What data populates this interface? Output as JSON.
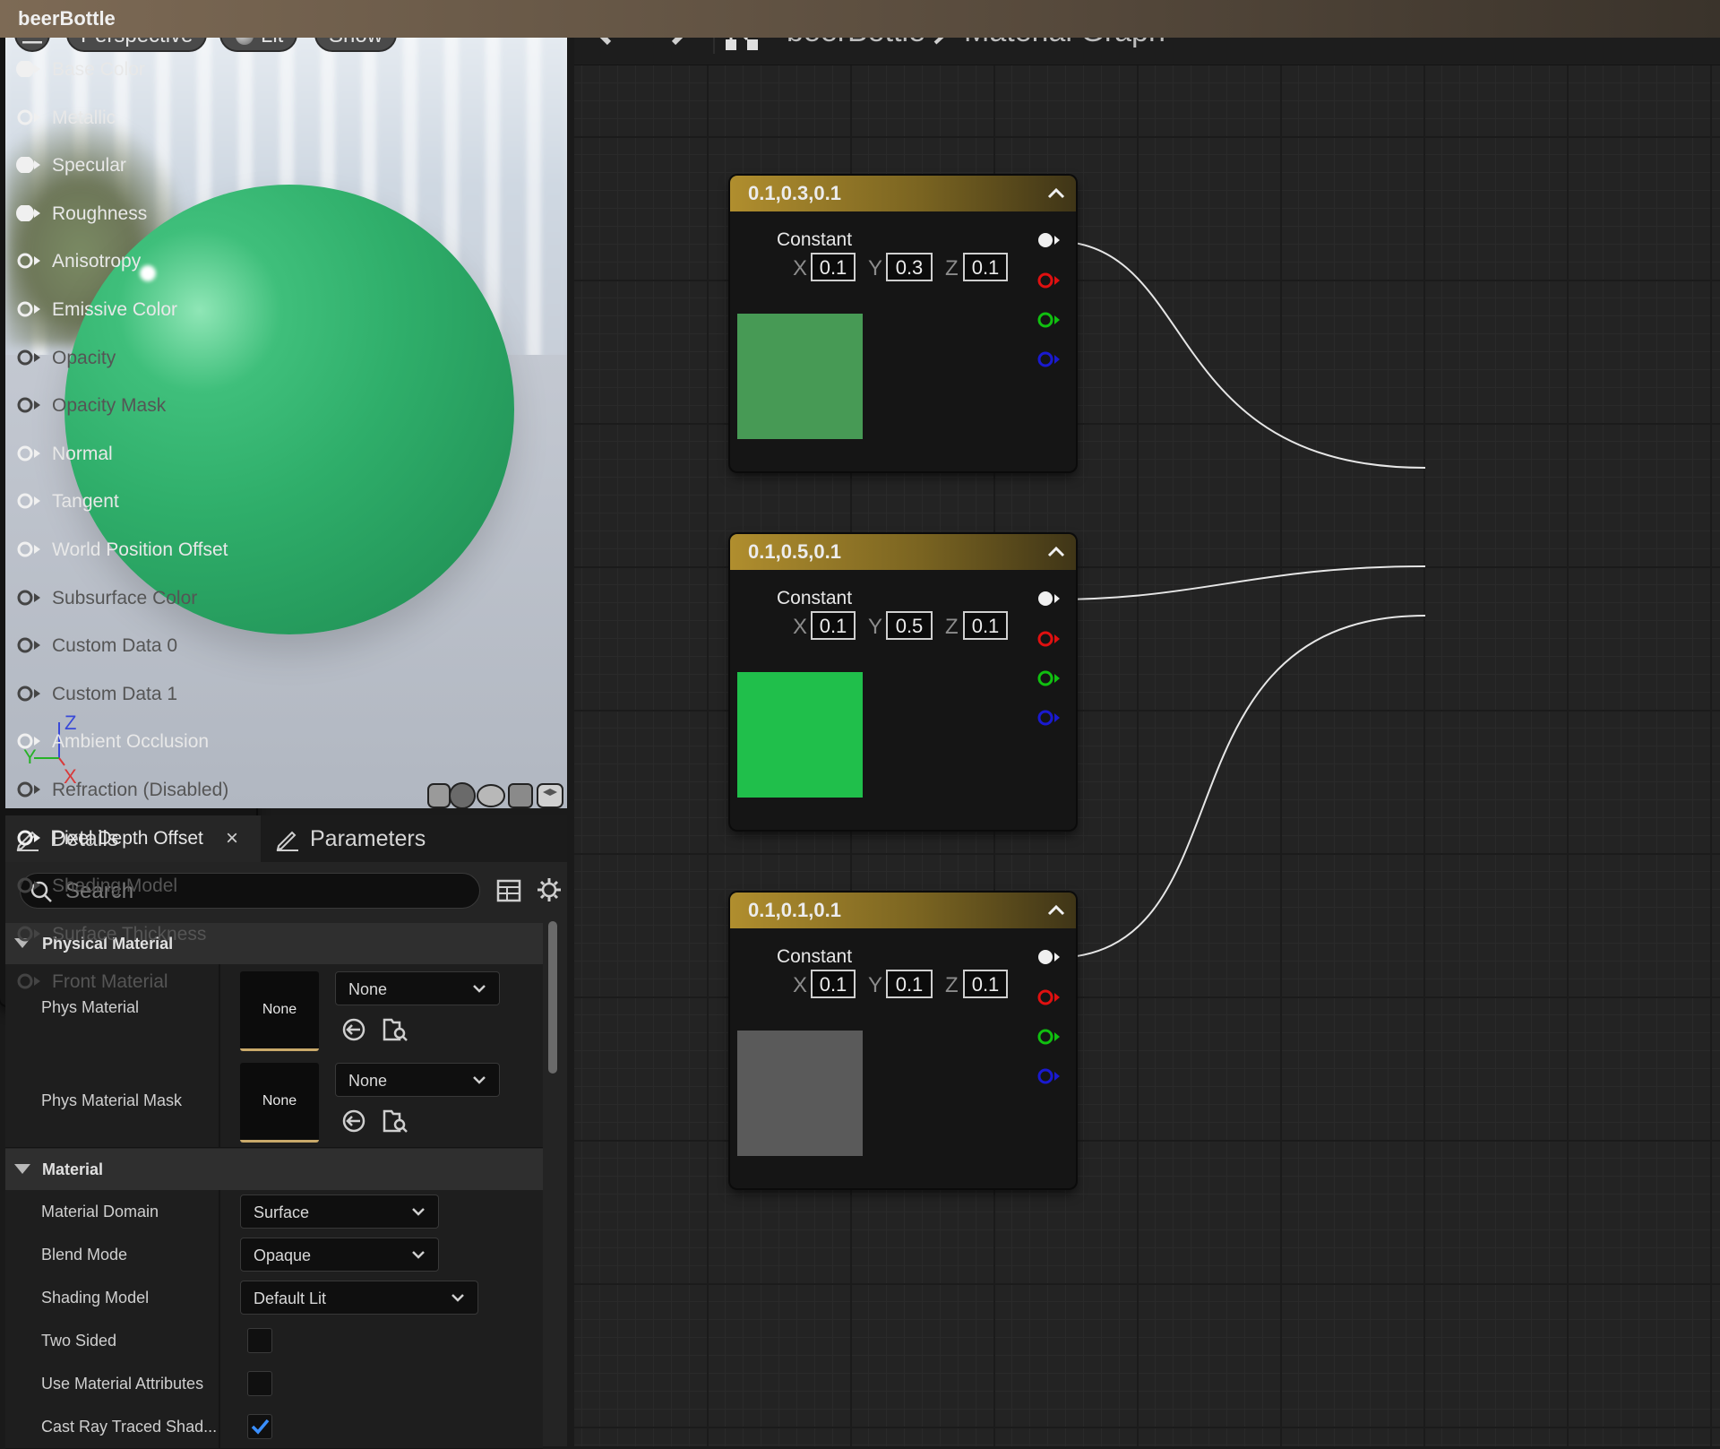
{
  "viewport": {
    "menu_icon": "hamburger-icon",
    "view_mode": "Perspective",
    "lighting": "Lit",
    "show": "Show",
    "axis": {
      "z": "Z",
      "y": "Y",
      "x": "X"
    }
  },
  "details": {
    "tabs": [
      {
        "label": "Details",
        "icon": "pencil-icon"
      },
      {
        "label": "Parameters",
        "icon": "pencil-icon"
      }
    ],
    "close_glyph": "×",
    "search_placeholder": "Search",
    "categories": {
      "physical_material": {
        "title": "Physical Material",
        "rows": [
          {
            "label": "Phys Material",
            "thumb": "None",
            "combo": "None"
          },
          {
            "label": "Phys Material Mask",
            "thumb": "None",
            "combo": "None"
          }
        ]
      },
      "material": {
        "title": "Material",
        "rows": [
          {
            "label": "Material Domain",
            "value": "Surface"
          },
          {
            "label": "Blend Mode",
            "value": "Opaque"
          },
          {
            "label": "Shading Model",
            "value": "Default Lit"
          },
          {
            "label": "Two Sided",
            "checked": false
          },
          {
            "label": "Use Material Attributes",
            "checked": false
          },
          {
            "label": "Cast Ray Traced Shad...",
            "checked": true
          }
        ]
      }
    }
  },
  "graph": {
    "breadcrumb": {
      "asset": "beerBottle",
      "graph": "Material Graph"
    },
    "nodes": [
      {
        "header": "0.1,0.3,0.1",
        "title": "Constant",
        "x": "0.1",
        "y": "0.3",
        "z": "0.1",
        "color": "#479a55"
      },
      {
        "header": "0.1,0.5,0.1",
        "title": "Constant",
        "x": "0.1",
        "y": "0.5",
        "z": "0.1",
        "color": "#20bf4b"
      },
      {
        "header": "0.1,0.1,0.1",
        "title": "Constant",
        "x": "0.1",
        "y": "0.1",
        "z": "0.1",
        "color": "#5a5a5a"
      }
    ],
    "component_labels": {
      "x": "X",
      "y": "Y",
      "z": "Z"
    },
    "material_node": {
      "title": "beerBottle",
      "inputs": [
        {
          "label": "Base Color",
          "enabled": true,
          "connected": true
        },
        {
          "label": "Metallic",
          "enabled": true,
          "connected": false
        },
        {
          "label": "Specular",
          "enabled": true,
          "connected": true
        },
        {
          "label": "Roughness",
          "enabled": true,
          "connected": true
        },
        {
          "label": "Anisotropy",
          "enabled": true,
          "connected": false
        },
        {
          "label": "Emissive Color",
          "enabled": true,
          "connected": false
        },
        {
          "label": "Opacity",
          "enabled": false,
          "connected": false
        },
        {
          "label": "Opacity Mask",
          "enabled": false,
          "connected": false
        },
        {
          "label": "Normal",
          "enabled": true,
          "connected": false
        },
        {
          "label": "Tangent",
          "enabled": true,
          "connected": false
        },
        {
          "label": "World Position Offset",
          "enabled": true,
          "connected": false
        },
        {
          "label": "Subsurface Color",
          "enabled": false,
          "connected": false
        },
        {
          "label": "Custom Data 0",
          "enabled": false,
          "connected": false
        },
        {
          "label": "Custom Data 1",
          "enabled": false,
          "connected": false
        },
        {
          "label": "Ambient Occlusion",
          "enabled": true,
          "connected": false
        },
        {
          "label": "Refraction (Disabled)",
          "enabled": false,
          "connected": false
        },
        {
          "label": "Pixel Depth Offset",
          "enabled": true,
          "connected": false
        },
        {
          "label": "Shading Model",
          "enabled": false,
          "connected": false
        },
        {
          "label": "Surface Thickness",
          "enabled": false,
          "connected": false
        },
        {
          "label": "Front Material",
          "enabled": false,
          "connected": false
        }
      ]
    }
  },
  "colors": {
    "accent_blue": "#2f6fe0",
    "node_header": "#b08e2e",
    "pin_red": "#e01010",
    "pin_green": "#10c010",
    "pin_blue": "#1a1ad0",
    "check_blue": "#3a8fff"
  }
}
